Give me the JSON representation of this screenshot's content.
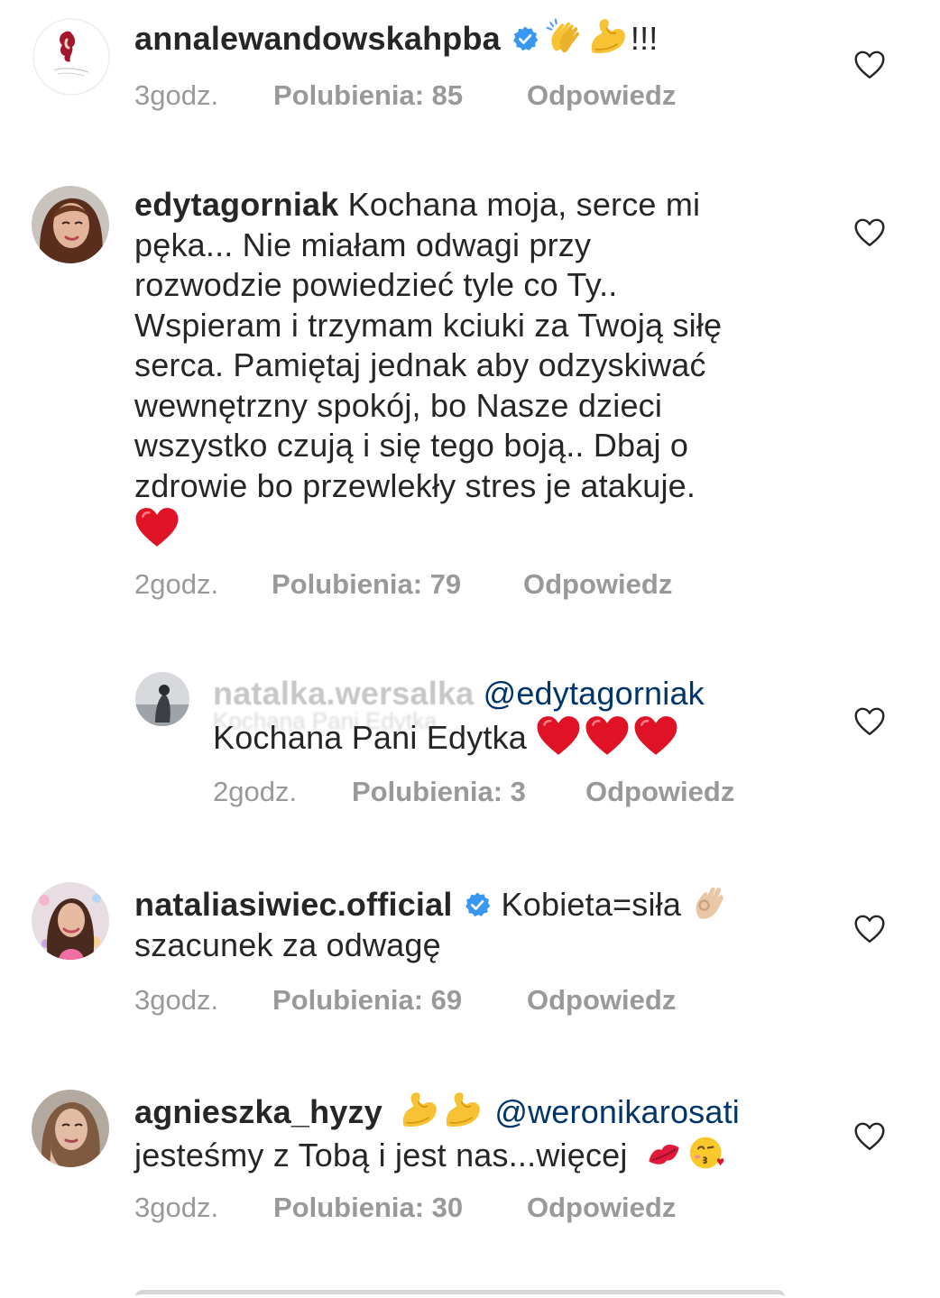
{
  "comments": [
    {
      "username": "annalewandowskahpba",
      "verified": true,
      "text": "!!!",
      "emojis_before_text": [
        "clapping-hands-emoji",
        "flexed-biceps-emoji"
      ],
      "time": "3godz.",
      "likes": "Polubienia: 85",
      "reply": "Odpowiedz"
    },
    {
      "username": "edytagorniak",
      "verified": false,
      "text_lines": [
        "Kochana moja, serce mi",
        "pęka... Nie miałam odwagi przy",
        "rozwodzie powiedzieć tyle co Ty..",
        "Wspieram i trzymam kciuki za Twoją siłę",
        "serca. Pamiętaj jednak aby odzyskiwać",
        "wewnętrzny spokój, bo Nasze dzieci",
        "wszystko czują i się tego boją.. Dbaj o",
        "zdrowie bo przewlekły stres je atakuje."
      ],
      "trailing_emoji": "red-heart-emoji",
      "time": "2godz.",
      "likes": "Polubienia: 79",
      "reply": "Odpowiedz"
    },
    {
      "username": "natalka.wersalka",
      "mention": "@edytagorniak",
      "ghost_text": "Kochana Pani Edytka",
      "text": "Kochana Pani Edytka",
      "emojis_after_text": [
        "red-heart-emoji",
        "red-heart-emoji",
        "red-heart-emoji"
      ],
      "time": "2godz.",
      "likes": "Polubienia: 3",
      "reply": "Odpowiedz"
    },
    {
      "username": "nataliasiwiec.official",
      "verified": true,
      "text": "Kobieta=siła",
      "emoji_after_text": "ok-hand-emoji",
      "text_line2": "szacunek za odwagę",
      "time": "3godz.",
      "likes": "Polubienia: 69",
      "reply": "Odpowiedz"
    },
    {
      "username": "agnieszka_hyzy",
      "verified": false,
      "emojis_after_name": [
        "flexed-biceps-emoji",
        "flexed-biceps-emoji"
      ],
      "mention": "@weronikarosati",
      "text_line2": "jesteśmy z Tobą i jest nas...więcej",
      "emojis_line2": [
        "kiss-mark-emoji",
        "face-blowing-kiss-emoji"
      ],
      "time": "3godz.",
      "likes": "Polubienia: 30",
      "reply": "Odpowiedz"
    }
  ],
  "colors": {
    "text": "#262626",
    "meta": "#999999",
    "mention": "#003569",
    "verified": "#3897f0",
    "heart_outline": "#262626"
  }
}
